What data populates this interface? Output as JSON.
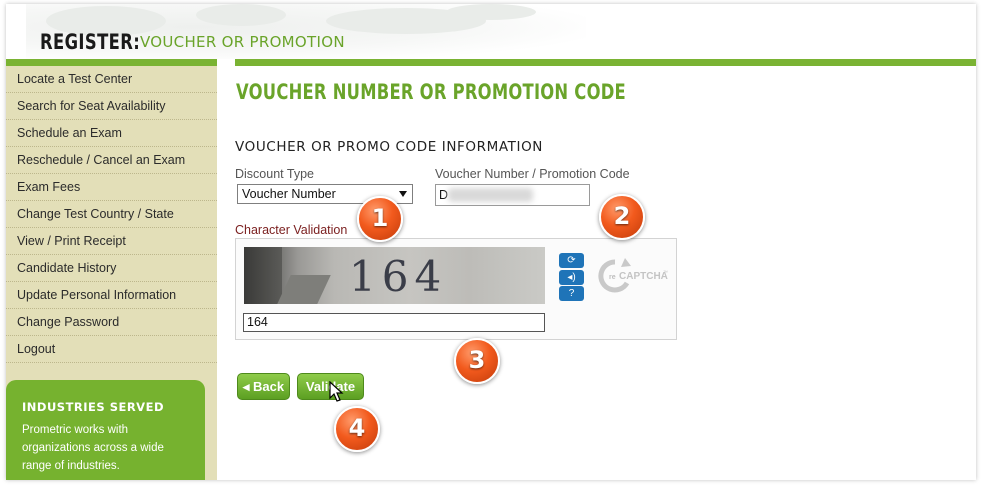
{
  "header": {
    "register_label": "REGISTER:",
    "section_label": "VOUCHER OR PROMOTION"
  },
  "sidebar": {
    "items": [
      {
        "label": "Locate a Test Center"
      },
      {
        "label": "Search for Seat Availability"
      },
      {
        "label": "Schedule an Exam"
      },
      {
        "label": "Reschedule / Cancel an Exam"
      },
      {
        "label": "Exam Fees"
      },
      {
        "label": "Change Test Country / State"
      },
      {
        "label": "View / Print Receipt"
      },
      {
        "label": "Candidate History"
      },
      {
        "label": "Update Personal Information"
      },
      {
        "label": "Change Password"
      },
      {
        "label": "Logout"
      }
    ],
    "industries": {
      "title": "INDUSTRIES SERVED",
      "text": "Prometric works with organizations across a wide range of industries."
    }
  },
  "main": {
    "page_title": "VOUCHER NUMBER OR PROMOTION CODE",
    "section_title": "VOUCHER OR PROMO CODE INFORMATION",
    "discount_type_label": "Discount Type",
    "discount_type_value": "Voucher Number",
    "voucher_label": "Voucher Number / Promotion Code",
    "voucher_value": "D",
    "char_validation_label": "Character Validation",
    "captcha_text": "164",
    "captcha_answer": "164",
    "recaptcha_logo_text": "reCAPTCHA™",
    "back_label": "◂ Back",
    "validate_label": "Validate"
  },
  "markers": [
    "1",
    "2",
    "3",
    "4"
  ],
  "colors": {
    "accent_green": "#7ab333",
    "title_green": "#6aa42a",
    "sidebar_bg": "#e3dfb8",
    "marker_orange": "#f25a1d",
    "captcha_button_blue": "#1f74b8"
  },
  "icons": [
    "refresh-icon",
    "audio-icon",
    "help-icon",
    "recaptcha-logo-icon",
    "mouse-cursor-icon"
  ]
}
